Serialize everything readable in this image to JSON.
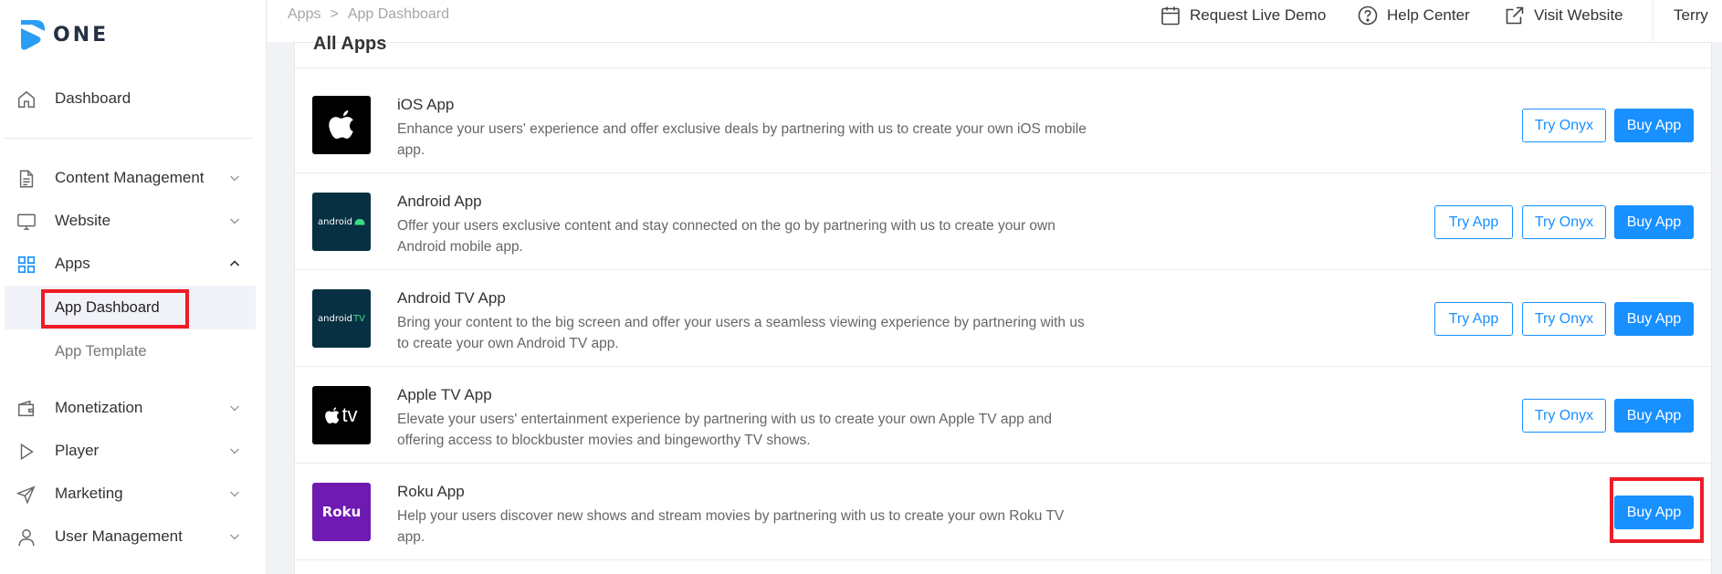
{
  "brand": {
    "name": "ONE"
  },
  "sidebar": {
    "items": [
      {
        "label": "Dashboard",
        "icon": "home-icon"
      },
      {
        "label": "Content Management",
        "icon": "document-icon"
      },
      {
        "label": "Website",
        "icon": "monitor-icon"
      },
      {
        "label": "Apps",
        "icon": "apps-grid-icon",
        "expanded": true
      },
      {
        "label": "App Dashboard",
        "active": true
      },
      {
        "label": "App Template"
      },
      {
        "label": "Monetization",
        "icon": "wallet-icon"
      },
      {
        "label": "Player",
        "icon": "play-icon"
      },
      {
        "label": "Marketing",
        "icon": "send-icon"
      },
      {
        "label": "User Management",
        "icon": "user-icon"
      }
    ]
  },
  "header": {
    "breadcrumb": [
      "Apps",
      ">",
      "App Dashboard"
    ],
    "links": [
      {
        "label": "Request Live Demo",
        "icon": "calendar-icon"
      },
      {
        "label": "Help Center",
        "icon": "help-circle-icon"
      },
      {
        "label": "Visit Website",
        "icon": "external-link-icon"
      }
    ],
    "user": "Terry"
  },
  "main": {
    "title": "All Apps",
    "apps": [
      {
        "name": "iOS App",
        "desc": "Enhance your users' experience and offer exclusive deals by partnering with us to create your own iOS mobile app.",
        "icon": "apple-logo-icon",
        "buttons": [
          "Try Onyx",
          "Buy App"
        ]
      },
      {
        "name": "Android App",
        "desc": "Offer your users exclusive content and stay connected on the go by partnering with us to create your own Android mobile app.",
        "icon": "android-logo-icon",
        "icon_text": "android",
        "buttons": [
          "Try App",
          "Try Onyx",
          "Buy App"
        ]
      },
      {
        "name": "Android TV App",
        "desc": "Bring your content to the big screen and offer your users a seamless viewing experience by partnering with us to create your own Android TV app.",
        "icon": "android-tv-logo-icon",
        "icon_text": "android",
        "icon_text_2": "TV",
        "buttons": [
          "Try App",
          "Try Onyx",
          "Buy App"
        ]
      },
      {
        "name": "Apple TV App",
        "desc": "Elevate your users' entertainment experience by partnering with us to create your own Apple TV app and offering access to blockbuster movies and bingeworthy TV shows.",
        "icon": "apple-tv-logo-icon",
        "icon_text": "tv",
        "buttons": [
          "Try Onyx",
          "Buy App"
        ]
      },
      {
        "name": "Roku App",
        "desc": "Help your users discover new shows and stream movies by partnering with us to create your own Roku TV app.",
        "icon": "roku-logo-icon",
        "icon_text": "Roku",
        "buttons": [
          "Buy App"
        ]
      }
    ]
  },
  "colors": {
    "accent": "#1890ff",
    "highlight": "#ee1c25",
    "logo": "#2a9df4",
    "ios_icon_bg": "#000000",
    "android_icon_bg": "#073042",
    "android_green": "#3ddc84",
    "appletv_icon_bg": "#000000",
    "roku_icon_bg": "#6f1ab1"
  }
}
